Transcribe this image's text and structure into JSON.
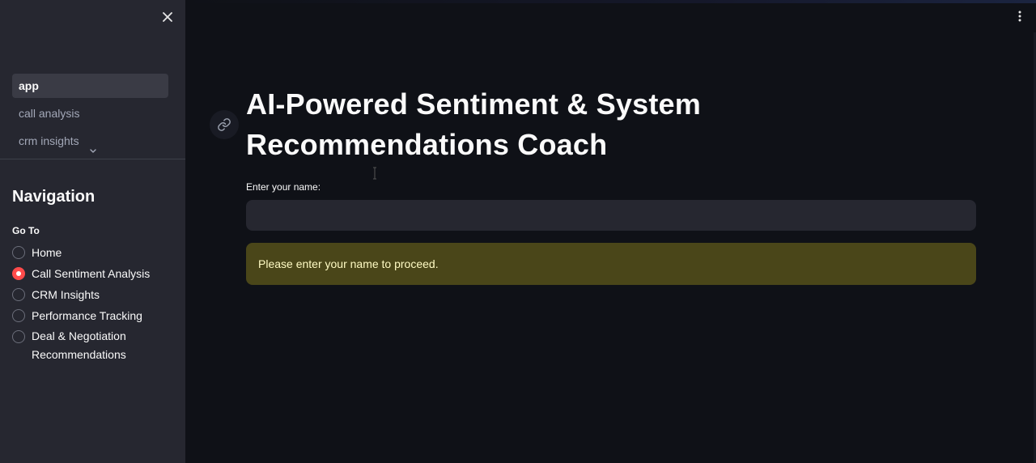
{
  "sidebar": {
    "pages": [
      {
        "label": "app",
        "active": true
      },
      {
        "label": "call analysis",
        "active": false
      },
      {
        "label": "crm insights",
        "active": false
      }
    ],
    "navigation_title": "Navigation",
    "goto_label": "Go To",
    "options": [
      {
        "label": "Home",
        "checked": false
      },
      {
        "label": "Call Sentiment Analysis",
        "checked": true
      },
      {
        "label": "CRM Insights",
        "checked": false
      },
      {
        "label": "Performance Tracking",
        "checked": false
      },
      {
        "label": "Deal & Negotiation Recommendations",
        "checked": false
      }
    ]
  },
  "main": {
    "title": "AI-Powered Sentiment & System Recommendations Coach",
    "name_label": "Enter your name:",
    "name_value": "",
    "name_placeholder": "",
    "warning": "Please enter your name to proceed."
  },
  "icons": {
    "close": "close-icon",
    "menu": "kebab-menu-icon",
    "anchor": "link-icon",
    "expand": "chevron-down-icon"
  },
  "colors": {
    "background": "#0f1117",
    "sidebar": "#262730",
    "accent": "#ff4b4b",
    "warning_bg": "#4a4619",
    "warning_text": "#fffbc4"
  }
}
